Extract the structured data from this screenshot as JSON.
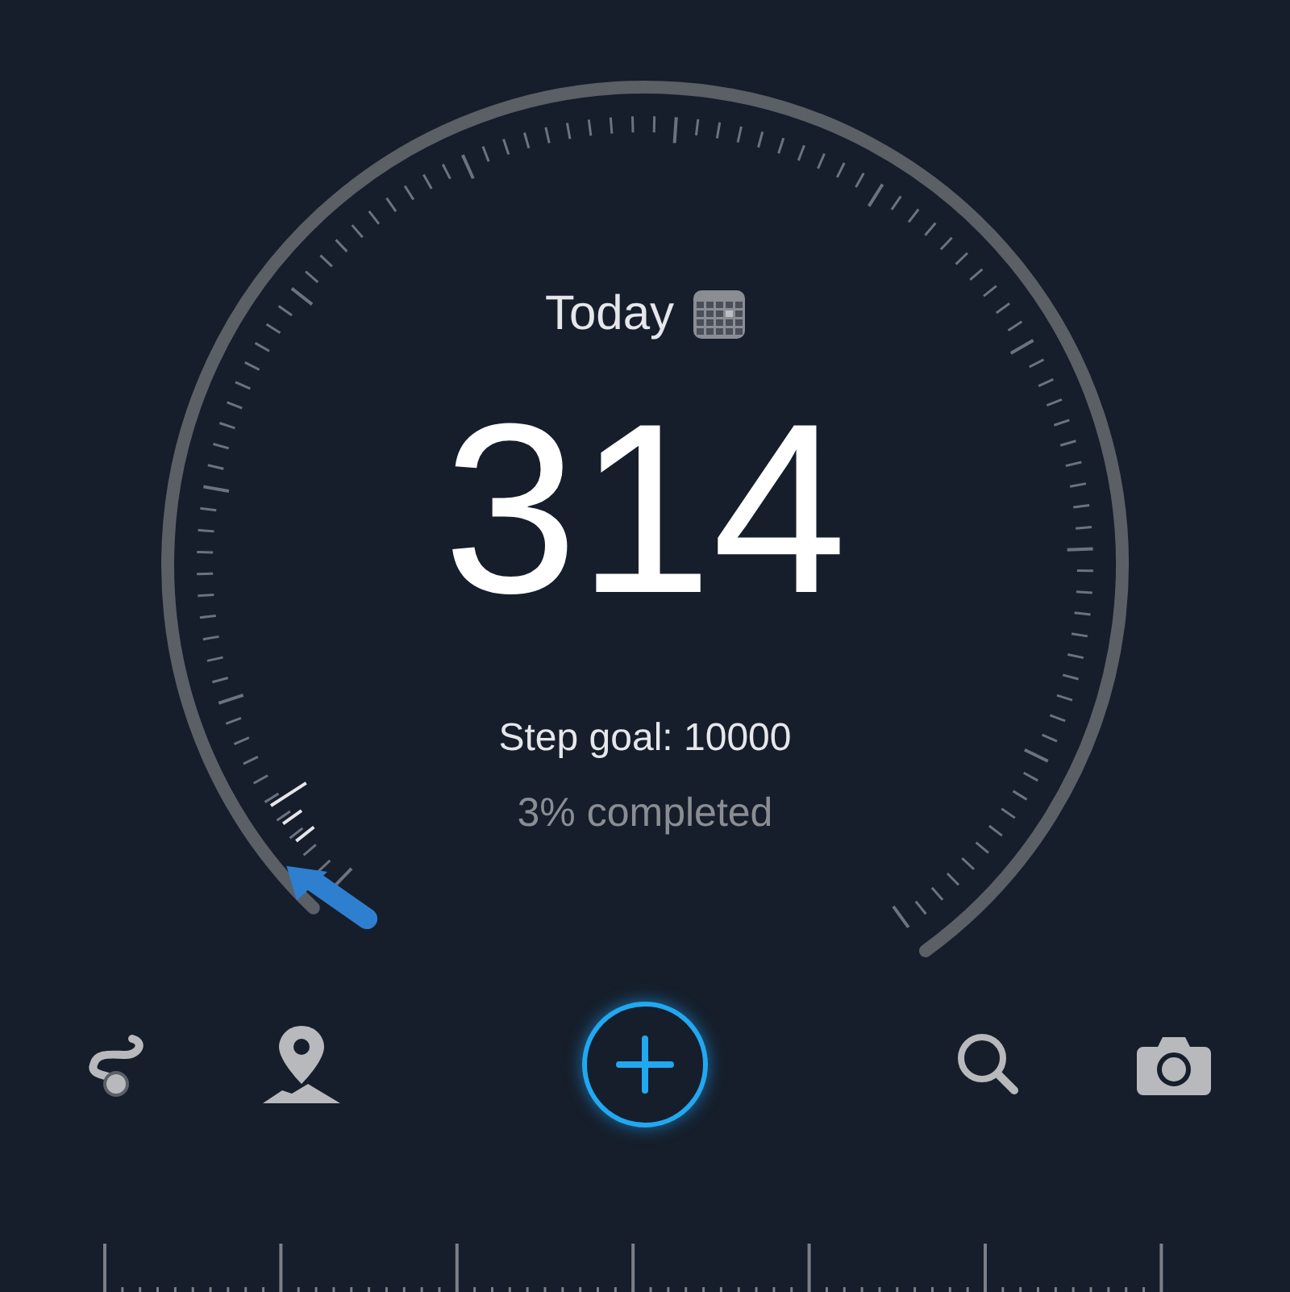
{
  "header": {
    "label": "Today"
  },
  "steps": {
    "count": "314",
    "goal": "Step goal: 10000",
    "completed": "3% completed"
  },
  "toolbar": [
    {
      "kind": "route"
    },
    {
      "kind": "map"
    },
    {
      "kind": "add"
    },
    {
      "kind": "search"
    },
    {
      "kind": "camera"
    }
  ]
}
